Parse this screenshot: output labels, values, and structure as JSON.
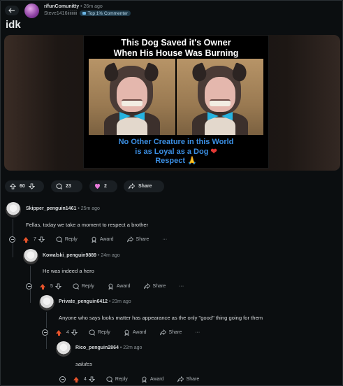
{
  "post": {
    "subreddit": "r/funComunitty",
    "time": "26m ago",
    "username": "Steve1416iiiiiiiii",
    "flair": "Top 1% Commenter",
    "title": "idk"
  },
  "meme": {
    "top_line1": "This Dog Saved it's Owner",
    "top_line2": "When His House Was Burning",
    "bottom_line1": "No Other Creature in this World",
    "bottom_line2": "is as Loyal  as a Dog",
    "bottom_line3": "Respect",
    "heart_glyph": "❤",
    "praise_glyph": "🙏"
  },
  "post_actions": {
    "votes": "60",
    "comments": "23",
    "awards": "2",
    "share": "Share"
  },
  "comments": [
    {
      "author": "Skipper_penguin1461",
      "time": "• 25m ago",
      "body": "Fellas, today we take a moment to respect a brother",
      "votes": "7",
      "reply": "Reply",
      "award": "Award",
      "share": "Share",
      "more": "···"
    },
    {
      "author": "Kowalski_penguin9889",
      "time": "• 24m ago",
      "body": "He was indeed a hero",
      "votes": "5",
      "reply": "Reply",
      "award": "Award",
      "share": "Share",
      "more": "···"
    },
    {
      "author": "Private_penguin6412",
      "time": "• 23m ago",
      "body": "Anyone who says looks matter has appearance as the only \"good\" thing going for them",
      "votes": "4",
      "reply": "Reply",
      "award": "Award",
      "share": "Share",
      "more": "···"
    },
    {
      "author": "Rico_penguin2864",
      "time": "• 22m ago",
      "body": "salutes",
      "votes": "4",
      "reply": "Reply",
      "award": "Award",
      "share": "Share",
      "more": ""
    }
  ]
}
